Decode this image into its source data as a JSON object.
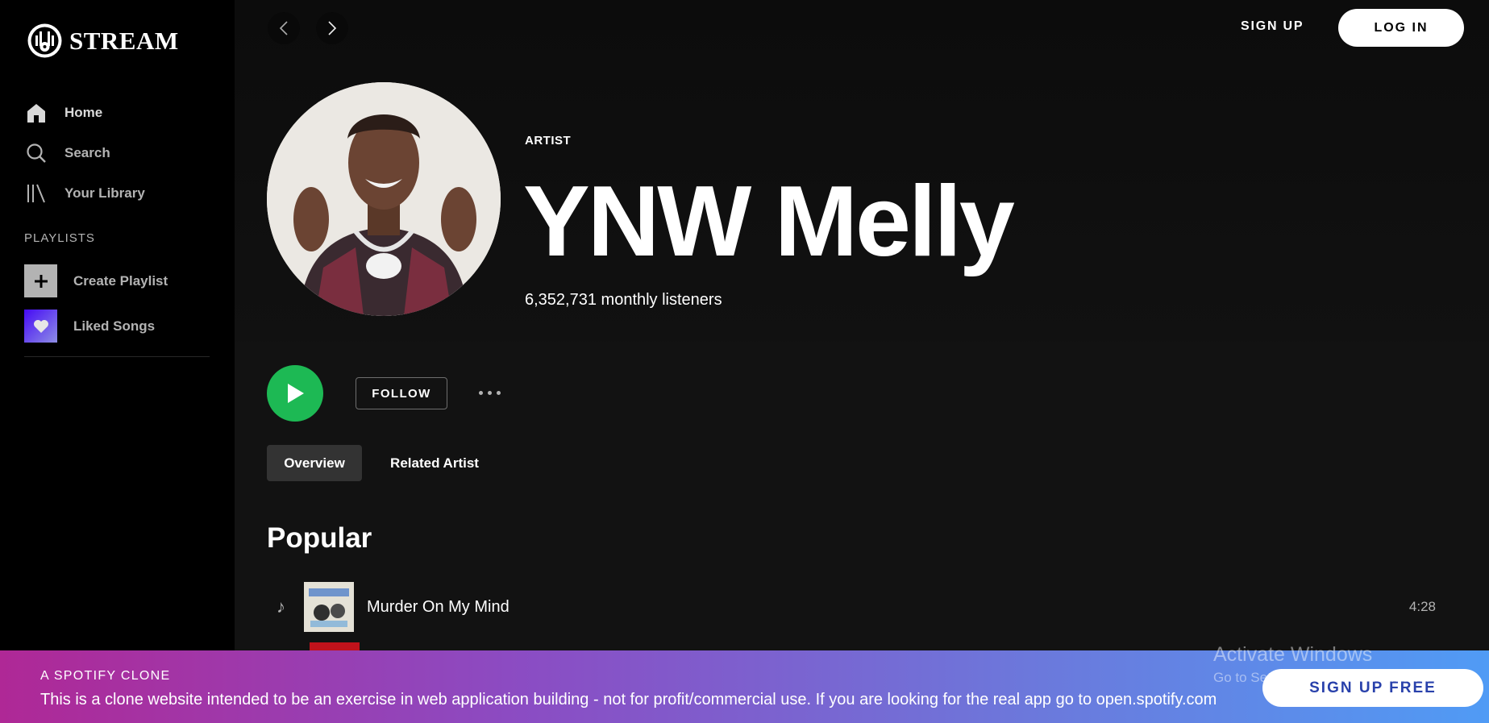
{
  "brand": {
    "name": "STREAM"
  },
  "sidebar": {
    "nav": [
      {
        "label": "Home",
        "icon": "home-icon"
      },
      {
        "label": "Search",
        "icon": "search-icon"
      },
      {
        "label": "Your Library",
        "icon": "library-icon"
      }
    ],
    "playlists_heading": "PLAYLISTS",
    "create_playlist": "Create Playlist",
    "liked_songs": "Liked Songs"
  },
  "header": {
    "signup_label": "SIGN UP",
    "login_label": "LOG IN"
  },
  "artist": {
    "label": "ARTIST",
    "name": "YNW Melly",
    "listeners": "6,352,731 monthly listeners"
  },
  "actions": {
    "follow_label": "FOLLOW"
  },
  "tabs": [
    {
      "label": "Overview",
      "active": true
    },
    {
      "label": "Related Artist",
      "active": false
    }
  ],
  "popular": {
    "heading": "Popular",
    "tracks": [
      {
        "title": "Murder On My Mind",
        "duration": "4:28"
      }
    ]
  },
  "banner": {
    "heading": "A SPOTIFY CLONE",
    "text": "This is a clone website intended to be an exercise in web application building - not for profit/commercial use. If you are looking for the real app go to open.spotify.com",
    "button": "SIGN UP FREE"
  },
  "watermark": {
    "title": "Activate Windows",
    "subtitle": "Go to Settings to activate Windows."
  },
  "colors": {
    "play_green": "#1db954",
    "sidebar_bg": "#000000",
    "main_bg": "#121212",
    "banner_start": "#af2896",
    "banner_end": "#509bf5"
  }
}
